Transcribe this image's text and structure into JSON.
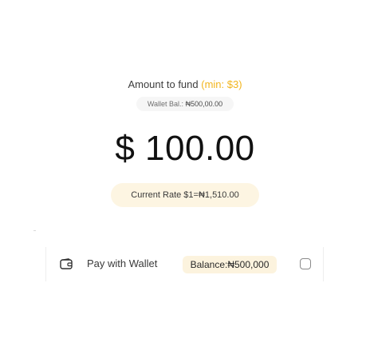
{
  "fund": {
    "heading": "Amount to fund",
    "min_note": "(min: $3)",
    "wallet_bal_label": "Wallet Bal.:",
    "wallet_bal_value": "₦500,00.00",
    "amount": "$ 100.00",
    "rate_text": "Current Rate $1=₦1,510.00"
  },
  "wallet_option": {
    "icon": "wallet-icon",
    "label": "Pay with Wallet",
    "balance": "Balance:₦500,000",
    "checked": false
  },
  "colors": {
    "accent": "#f2b51d",
    "rate_pill_bg": "#fdf5e2",
    "balance_badge_bg": "#fcf3de"
  }
}
